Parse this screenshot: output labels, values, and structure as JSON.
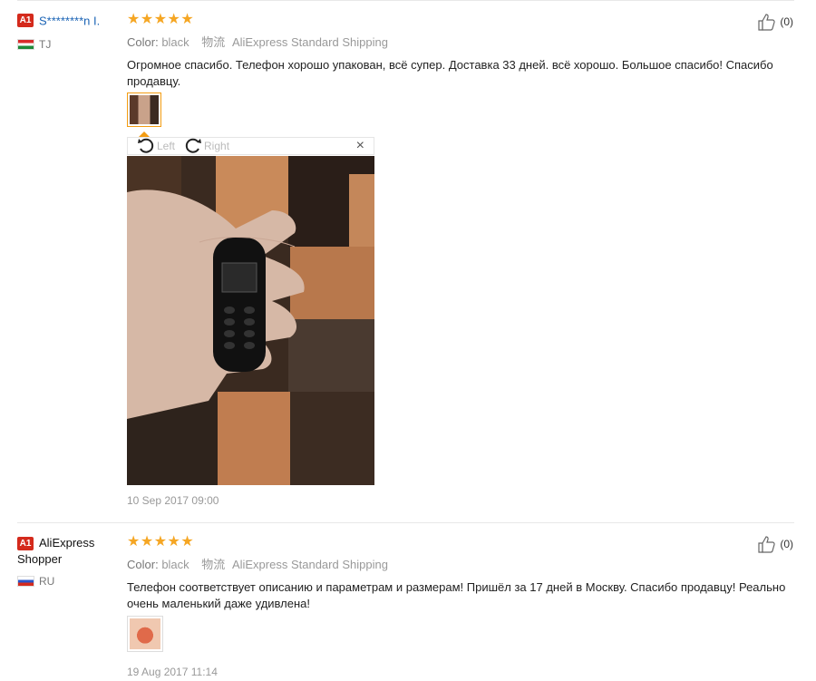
{
  "reviews": [
    {
      "badge": "A1",
      "user": "S********n I.",
      "country": "TJ",
      "stars": "★★★★★",
      "color_label": "Color:",
      "color_value": "black",
      "shipping_icon": "物流",
      "shipping": "AliExpress Standard Shipping",
      "text": "Огромное спасибо. Телефон хорошо упакован, всё супер. Доставка 33 дней. всё хорошо. Большое спасибо! Спасибо продавцу.",
      "date": "10 Sep 2017 09:00",
      "likes": "(0)",
      "viewer": {
        "left_label": "Left",
        "right_label": "Right",
        "close": "×"
      }
    },
    {
      "badge": "A1",
      "user_line1": "AliExpress",
      "user_line2": "Shopper",
      "country": "RU",
      "stars": "★★★★★",
      "color_label": "Color:",
      "color_value": "black",
      "shipping_icon": "物流",
      "shipping": "AliExpress Standard Shipping",
      "text": "Телефон соответствует описанию и параметрам и размерам! Пришёл за 17 дней в Москву. Спасибо продавцу! Реально очень маленький даже удивлена!",
      "date": "19 Aug 2017 11:14",
      "likes": "(0)"
    }
  ],
  "icons": {
    "flag_tj": "flag-tj-icon",
    "flag_ru": "flag-ru-icon",
    "thumbs_up": "thumbs-up-icon",
    "rotate_left": "rotate-left-icon",
    "rotate_right": "rotate-right-icon",
    "close": "close-icon"
  },
  "colors": {
    "star": "#f5a623",
    "badge": "#d42a1c",
    "link": "#1a63b5",
    "active_thumb": "#f39c12"
  }
}
